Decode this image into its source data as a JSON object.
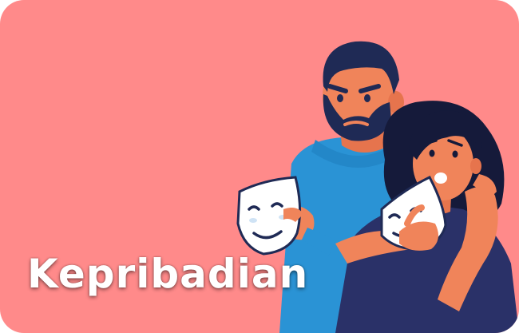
{
  "card": {
    "title": "Kepribadian",
    "background_color": "#ff8a8a",
    "title_color": "#ffffff"
  },
  "illustration": {
    "subject": "man-and-woman-holding-masks",
    "icons": [
      "smiling-mask-icon",
      "smiling-mask-icon"
    ]
  }
}
